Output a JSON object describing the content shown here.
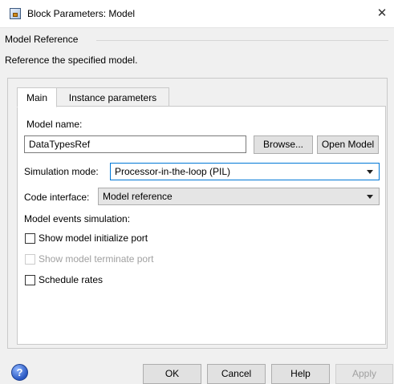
{
  "window": {
    "title": "Block Parameters: Model",
    "close_glyph": "✕"
  },
  "header": {
    "section_title": "Model Reference",
    "description": "Reference the specified model."
  },
  "tabs": [
    {
      "label": "Main",
      "active": true
    },
    {
      "label": "Instance parameters",
      "active": false
    }
  ],
  "main": {
    "model_name_label": "Model name:",
    "model_name_value": "DataTypesRef",
    "browse_label": "Browse...",
    "open_model_label": "Open Model",
    "simulation_mode_label": "Simulation mode:",
    "simulation_mode_value": "Processor-in-the-loop (PIL)",
    "code_interface_label": "Code interface:",
    "code_interface_value": "Model reference",
    "model_events_label": "Model events simulation:",
    "checkboxes": [
      {
        "label": "Show model initialize port",
        "checked": false,
        "enabled": true
      },
      {
        "label": "Show model terminate port",
        "checked": false,
        "enabled": false
      },
      {
        "label": "Schedule rates",
        "checked": false,
        "enabled": true
      }
    ]
  },
  "footer": {
    "help_icon_glyph": "?",
    "ok_label": "OK",
    "cancel_label": "Cancel",
    "help_label": "Help",
    "apply_label": "Apply"
  },
  "colors": {
    "focus_border": "#0078d7",
    "window_bg": "#f0f0f0",
    "disabled_text": "#a0a0a0"
  }
}
